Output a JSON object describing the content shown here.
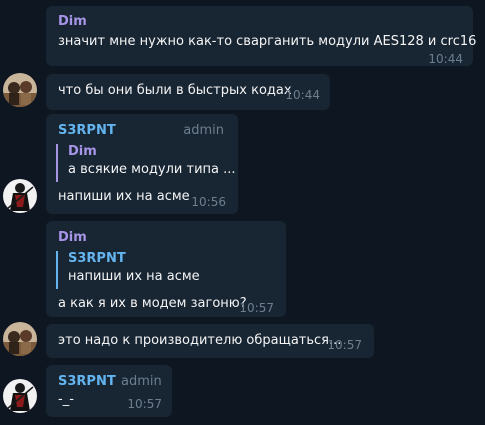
{
  "messages": [
    {
      "sender": "Dim",
      "text": "значит мне нужно как-то сварганить  модули AES128 и crc16",
      "time": "10:44"
    },
    {
      "text": "что бы они были в быстрых кодах",
      "time": "10:44"
    },
    {
      "sender": "S3RPNT",
      "role": "admin",
      "reply_name": "Dim",
      "reply_text": "а всякие модули типа ...",
      "text": "напиши их на асме",
      "time": "10:56"
    },
    {
      "sender": "Dim",
      "reply_name": "S3RPNT",
      "reply_text": "напиши их на асме",
      "text": "а как я их в модем загоню?",
      "time": "10:57"
    },
    {
      "text": "это надо к производителю обращаться...",
      "time": "10:57"
    },
    {
      "sender": "S3RPNT",
      "role": "admin",
      "text": "-_-",
      "time": "10:57"
    }
  ],
  "colors": {
    "background": "#0e1621",
    "bubble": "#182533",
    "name_purple": "#a695e7",
    "name_blue": "#64b5ef",
    "meta": "#6d7f8f"
  }
}
